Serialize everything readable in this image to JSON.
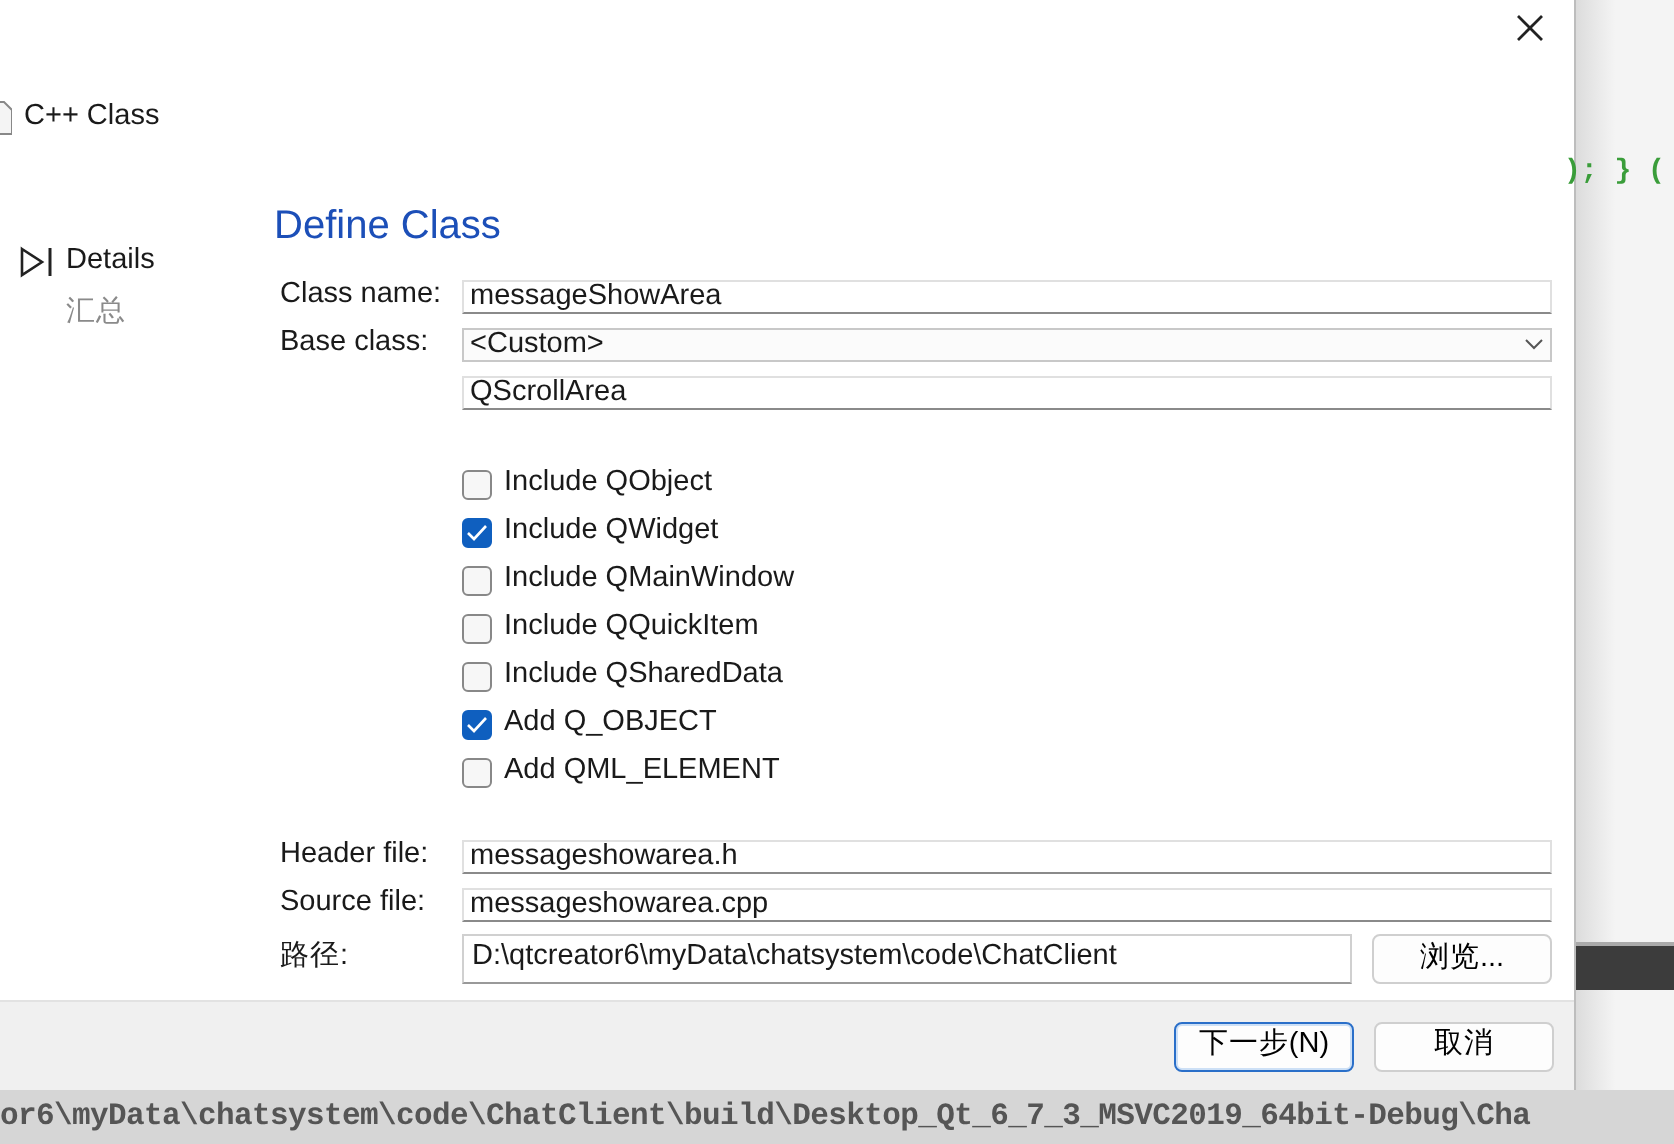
{
  "wizard_title": "C++ Class",
  "steps": [
    {
      "label": "Details",
      "selected": true
    },
    {
      "label": "汇总",
      "selected": false
    }
  ],
  "page_title": "Define Class",
  "class_fields": [
    {
      "kind": "text",
      "label": "Class name:",
      "value": "messageShowArea"
    },
    {
      "kind": "combo",
      "label": "Base class:",
      "value": "<Custom>"
    },
    {
      "kind": "text",
      "value": "QScrollArea"
    }
  ],
  "options": [
    {
      "label": "Include QObject",
      "checked": false
    },
    {
      "label": "Include QWidget",
      "checked": true
    },
    {
      "label": "Include QMainWindow",
      "checked": false
    },
    {
      "label": "Include QQuickItem",
      "checked": false
    },
    {
      "label": "Include QSharedData",
      "checked": false
    },
    {
      "label": "Add Q_OBJECT",
      "checked": true
    },
    {
      "label": "Add QML_ELEMENT",
      "checked": false
    }
  ],
  "file_fields": [
    {
      "label": "Header file:",
      "value": "messageshowarea.h"
    },
    {
      "label": "Source file:",
      "value": "messageshowarea.cpp"
    }
  ],
  "path": {
    "label": "路径:",
    "value": "D:\\qtcreator6\\myData\\chatsystem\\code\\ChatClient",
    "browse": "浏览..."
  },
  "buttons": [
    {
      "label": "下一步(N)",
      "default": true
    },
    {
      "label": "取消",
      "default": false
    }
  ],
  "editor_code": "); } (",
  "build_path": "or6\\myData\\chatsystem\\code\\ChatClient\\build\\Desktop_Qt_6_7_3_MSVC2019_64bit-Debug\\Cha"
}
